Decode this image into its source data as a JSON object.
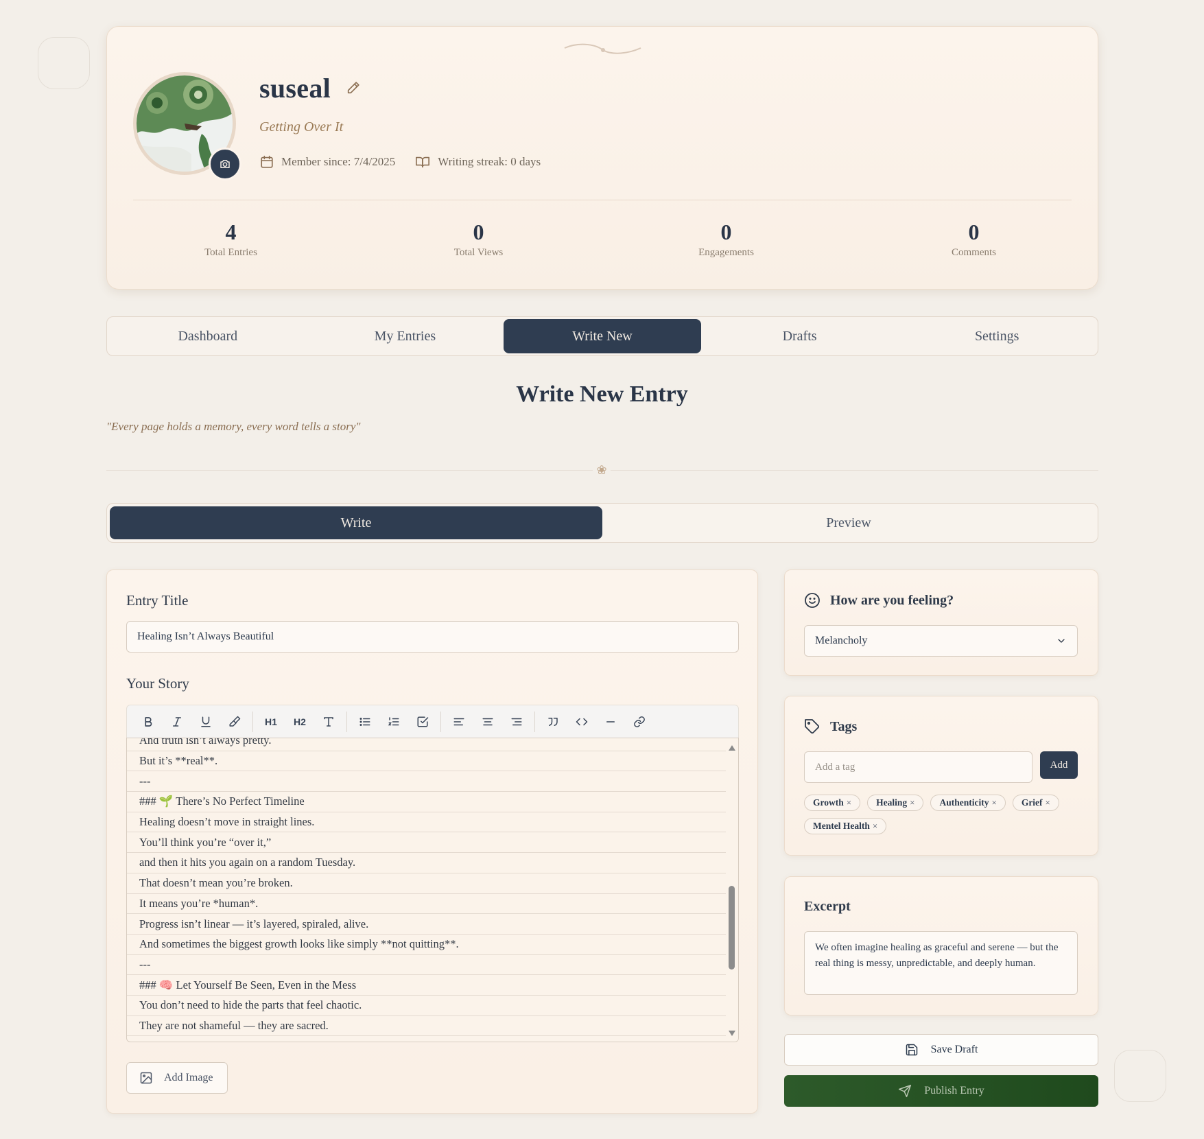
{
  "profile": {
    "username": "suseal",
    "subtitle": "Getting Over It",
    "member_since": "Member since: 7/4/2025",
    "writing_streak": "Writing streak: 0 days",
    "stats": [
      {
        "value": "4",
        "label": "Total Entries"
      },
      {
        "value": "0",
        "label": "Total Views"
      },
      {
        "value": "0",
        "label": "Engagements"
      },
      {
        "value": "0",
        "label": "Comments"
      }
    ]
  },
  "nav": {
    "tabs": [
      "Dashboard",
      "My Entries",
      "Write New",
      "Drafts",
      "Settings"
    ],
    "active": "Write New"
  },
  "page": {
    "title": "Write New Entry",
    "quote": "\"Every page holds a memory, every word tells a story\"",
    "ornament": "❀"
  },
  "mode": {
    "write_label": "Write",
    "preview_label": "Preview"
  },
  "editor": {
    "title_label": "Entry Title",
    "title_value": "Healing Isn’t Always Beautiful",
    "story_label": "Your Story",
    "toolbar": {
      "h1": "H1",
      "h2": "H2"
    },
    "lines": [
      "And truth isn’t always pretty.",
      "But it’s **real**.",
      "---",
      "### 🌱 There’s No Perfect Timeline",
      "Healing doesn’t move in straight lines.",
      "You’ll think you’re “over it,”",
      "and then it hits you again on a random Tuesday.",
      "That doesn’t mean you’re broken.",
      "It means you’re *human*.",
      "Progress isn’t linear — it’s layered, spiraled, alive.",
      "And sometimes the biggest growth looks like simply **not quitting**.",
      "---",
      "### 🧠 Let Yourself Be Seen, Even in the Mess",
      "You don’t need to hide the parts that feel chaotic.",
      "They are not shameful — they are sacred."
    ],
    "add_image_label": "Add Image"
  },
  "mood": {
    "heading": "How are you feeling?",
    "selected": "Melancholy"
  },
  "tags": {
    "heading": "Tags",
    "input_placeholder": "Add a tag",
    "add_label": "Add",
    "items": [
      "Growth",
      "Healing",
      "Authenticity",
      "Grief",
      "Mentel Health"
    ]
  },
  "excerpt": {
    "heading": "Excerpt",
    "text": "We often imagine healing as graceful and serene — but the real thing is messy, unpredictable, and deeply human."
  },
  "actions": {
    "save_draft": "Save Draft",
    "publish": "Publish Entry"
  },
  "colors": {
    "primary": "#2f3d51",
    "publish": "#2d5a2a",
    "background": "#f3efe9"
  }
}
